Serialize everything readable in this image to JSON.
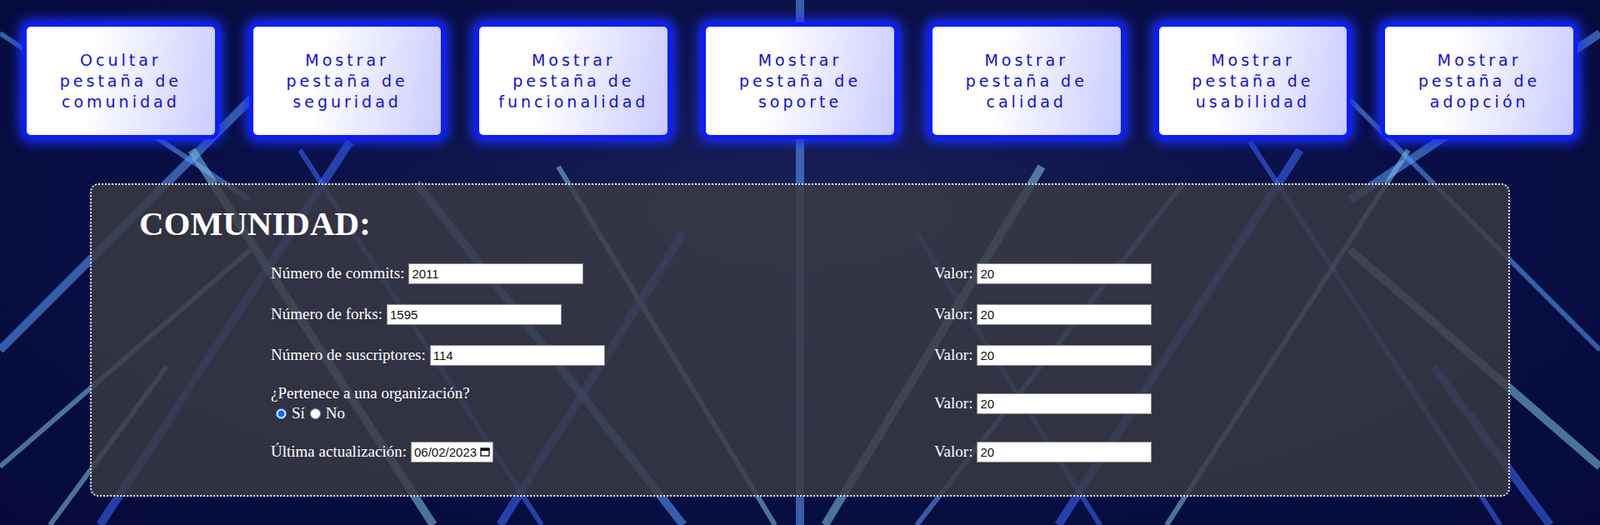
{
  "tab_buttons": [
    {
      "label": "Ocultar pestaña de comunidad"
    },
    {
      "label": "Mostrar pestaña de seguridad"
    },
    {
      "label": "Mostrar pestaña de funcionalidad"
    },
    {
      "label": "Mostrar pestaña de soporte"
    },
    {
      "label": "Mostrar pestaña de calidad"
    },
    {
      "label": "Mostrar pestaña de usabilidad"
    },
    {
      "label": "Mostrar pestaña de adopción"
    }
  ],
  "panel": {
    "title": "COMUNIDAD:",
    "fields": [
      {
        "kind": "text",
        "label": "Número de commits:",
        "value": "2011",
        "score_label": "Valor:",
        "score": "20"
      },
      {
        "kind": "text",
        "label": "Número de forks:",
        "value": "1595",
        "score_label": "Valor:",
        "score": "20"
      },
      {
        "kind": "text",
        "label": "Número de suscriptores:",
        "value": "114",
        "score_label": "Valor:",
        "score": "20"
      },
      {
        "kind": "radio",
        "label": "¿Pertenece a una organización?",
        "options": [
          {
            "label": "Sí",
            "selected": true
          },
          {
            "label": "No",
            "selected": false
          }
        ],
        "score_label": "Valor:",
        "score": "20"
      },
      {
        "kind": "date",
        "label": "Última actualización:",
        "value": "06/02/2023",
        "score_label": "Valor:",
        "score": "20"
      }
    ]
  }
}
